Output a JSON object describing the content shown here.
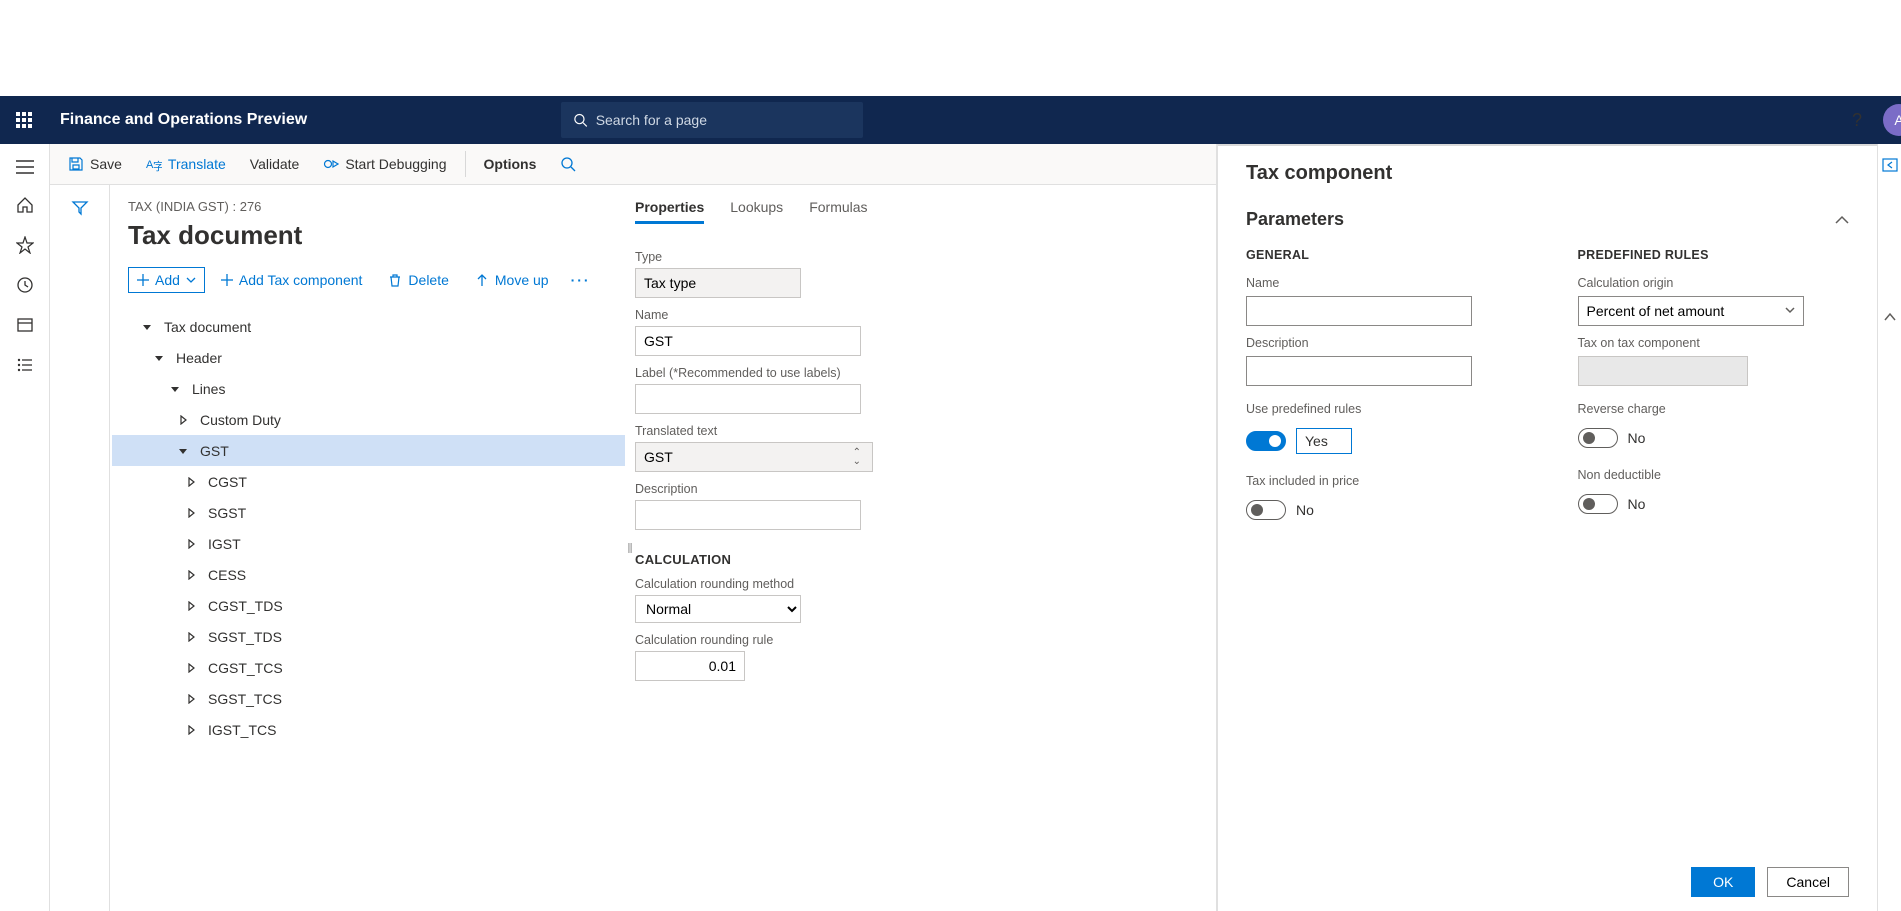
{
  "navbar": {
    "brand": "Finance and Operations Preview",
    "search_placeholder": "Search for a page",
    "help_icon": "?",
    "avatar_initial": "A"
  },
  "actionbar": {
    "save": "Save",
    "translate": "Translate",
    "validate": "Validate",
    "start_debugging": "Start Debugging",
    "options": "Options"
  },
  "page": {
    "breadcrumb": "TAX (INDIA GST) : 276",
    "title": "Tax document"
  },
  "list_toolbar": {
    "add": "Add",
    "add_tax_component": "Add Tax component",
    "delete": "Delete",
    "move_up": "Move up"
  },
  "tree": [
    {
      "label": "Tax document",
      "level": 0,
      "expanded": true
    },
    {
      "label": "Header",
      "level": 1,
      "expanded": true
    },
    {
      "label": "Lines",
      "level": 2,
      "expanded": true
    },
    {
      "label": "Custom Duty",
      "level": 3,
      "expanded": false
    },
    {
      "label": "GST",
      "level": 3,
      "expanded": true,
      "selected": true
    },
    {
      "label": "CGST",
      "level": 4,
      "expanded": false
    },
    {
      "label": "SGST",
      "level": 4,
      "expanded": false
    },
    {
      "label": "IGST",
      "level": 4,
      "expanded": false
    },
    {
      "label": "CESS",
      "level": 4,
      "expanded": false
    },
    {
      "label": "CGST_TDS",
      "level": 4,
      "expanded": false
    },
    {
      "label": "SGST_TDS",
      "level": 4,
      "expanded": false
    },
    {
      "label": "CGST_TCS",
      "level": 4,
      "expanded": false
    },
    {
      "label": "SGST_TCS",
      "level": 4,
      "expanded": false
    },
    {
      "label": "IGST_TCS",
      "level": 4,
      "expanded": false
    }
  ],
  "tabs": {
    "properties": "Properties",
    "lookups": "Lookups",
    "formulas": "Formulas"
  },
  "properties": {
    "type_label": "Type",
    "type_value": "Tax type",
    "name_label": "Name",
    "name_value": "GST",
    "label_label": "Label (*Recommended to use labels)",
    "label_value": "",
    "translated_label": "Translated text",
    "translated_value": "GST",
    "description_label": "Description",
    "description_value": "",
    "calc_header": "CALCULATION",
    "rounding_method_label": "Calculation rounding method",
    "rounding_method_value": "Normal",
    "rounding_rule_label": "Calculation rounding rule",
    "rounding_rule_value": "0.01"
  },
  "dialog": {
    "title": "Tax component",
    "parameters_header": "Parameters",
    "col_general": "GENERAL",
    "col_predefined": "PREDEFINED RULES",
    "name_label": "Name",
    "name_value": "",
    "description_label": "Description",
    "description_value": "",
    "use_predefined_label": "Use predefined rules",
    "use_predefined_value": "Yes",
    "tax_included_label": "Tax included in price",
    "tax_included_value": "No",
    "calc_origin_label": "Calculation origin",
    "calc_origin_value": "Percent of net amount",
    "tax_on_tax_label": "Tax on tax component",
    "reverse_charge_label": "Reverse charge",
    "reverse_charge_value": "No",
    "non_deductible_label": "Non deductible",
    "non_deductible_value": "No",
    "ok": "OK",
    "cancel": "Cancel"
  }
}
